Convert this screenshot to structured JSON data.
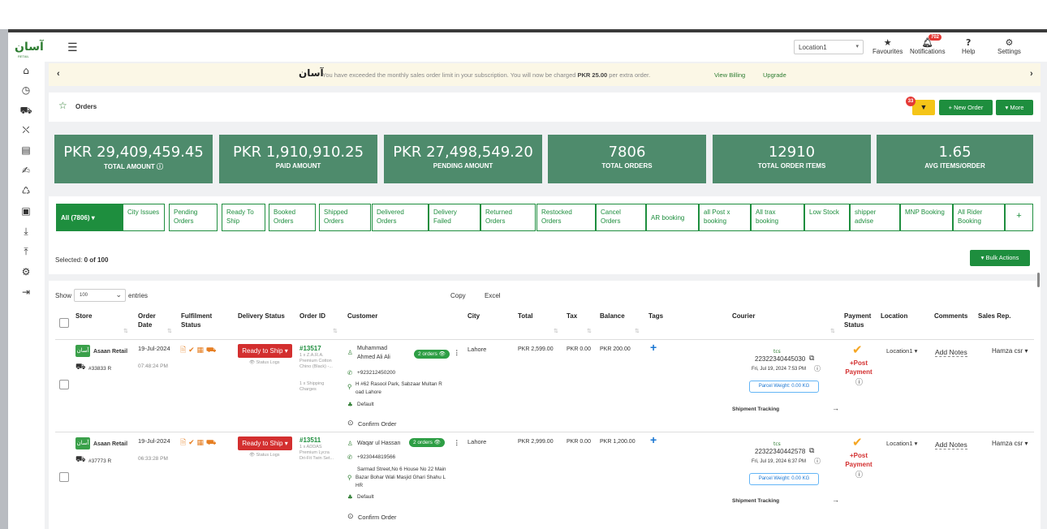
{
  "brand": {
    "logo": "آسان",
    "sub": "RETAIL"
  },
  "topbar": {
    "location": "Location1",
    "favourites": "Favourites",
    "notifications": "Notifications",
    "notif_count": "702",
    "help": "Help",
    "settings": "Settings"
  },
  "banner": {
    "message_pre": "You have exceeded the monthly sales order limit in your subscription. You will now be charged",
    "amount": "PKR 25.00",
    "message_post": "per extra order.",
    "view_billing": "View Billing",
    "upgrade": "Upgrade"
  },
  "header": {
    "title": "Orders",
    "filter_count": "33",
    "new_order": "+ New Order",
    "more": "▾ More"
  },
  "stats": [
    {
      "value": "PKR 29,409,459.45",
      "label": "TOTAL AMOUNT ⓘ"
    },
    {
      "value": "PKR 1,910,910.25",
      "label": "PAID AMOUNT"
    },
    {
      "value": "PKR 27,498,549.20",
      "label": "PENDING AMOUNT"
    },
    {
      "value": "7806",
      "label": "TOTAL ORDERS"
    },
    {
      "value": "12910",
      "label": "TOTAL ORDER ITEMS"
    },
    {
      "value": "1.65",
      "label": "AVG ITEMS/ORDER"
    }
  ],
  "tabs": {
    "all": "All   (7806)  ▾",
    "t1": "City Issues",
    "t2": "Pending Orders",
    "t3": "Ready To Ship",
    "t4": "Booked Orders",
    "t5": "Shipped Orders",
    "t6": "Delivered Orders",
    "t7": "Delivery Failed",
    "t8": "Returned Orders",
    "t9": "Restocked Orders",
    "t10": "Cancel Orders",
    "t11": "AR booking",
    "t12": "all Post x booking",
    "t13": "All trax booking",
    "t14": "Low Stock",
    "t15": "shipper advise",
    "t16": "MNP Booking",
    "t17": "All Rider Booking",
    "plus": "+"
  },
  "selection": {
    "label": "Selected:",
    "count": "0 of 100",
    "bulk": "▾  Bulk Actions"
  },
  "table": {
    "show": "Show",
    "page_size": "100",
    "entries": "entries",
    "copy": "Copy",
    "excel": "Excel",
    "headers": {
      "store": "Store",
      "order_date": "Order Date",
      "fulfilment": "Fulfilment Status",
      "delivery": "Delivery Status",
      "order_id": "Order ID",
      "customer": "Customer",
      "city": "City",
      "total": "Total",
      "tax": "Tax",
      "balance": "Balance",
      "tags": "Tags",
      "courier": "Courier",
      "payment": "Payment Status",
      "location": "Location",
      "comments": "Comments",
      "sales_rep": "Sales Rep."
    },
    "rows": [
      {
        "store": "Asaan Retail",
        "ref": "#33833 R",
        "date": "19-Jul-2024",
        "time": "07:48:24 PM",
        "status": "Ready to Ship ▾",
        "status_logs": "👁 Status Logs",
        "order_id": "#13517",
        "item1": "1 x Z.A.R.A.",
        "item2": "Premium Cotton",
        "item3": "Chino (Black) -...",
        "item4": "1 x Shipping",
        "item5": "Charges",
        "cust_name1": "Muhammad",
        "cust_name2": "Ahmed Ali Ali",
        "orders_pill": "2 orders 👁",
        "phone": "+923212450200",
        "addr1": "H #62 Rasool Park, Sabzaar Multan R",
        "addr2": "oad Lahore",
        "default": "Default",
        "confirm": "Confirm Order",
        "city": "Lahore",
        "total": "PKR 2,599.00",
        "tax": "PKR 0.00",
        "balance": "PKR 200.00",
        "tracking": "22322340445030",
        "track_date": "Fri, Jul 19, 2024 7:53 PM",
        "parcel": "Parcel Weight: 0.00 KG",
        "shipment": "Shipment Tracking",
        "post_payment": "+Post Payment",
        "location": "Location1 ▾",
        "add_notes": "Add Notes",
        "rep": "Hamza csr ▾"
      },
      {
        "store": "Asaan Retail",
        "ref": "#37773 R",
        "date": "19-Jul-2024",
        "time": "06:33:28 PM",
        "status": "Ready to Ship ▾",
        "status_logs": "👁 Status Logs",
        "order_id": "#13511",
        "item1": "1 x ADDAS",
        "item2": "Premium Lycra",
        "item3": "Dri-Fit Twin Set...",
        "cust_name1": "Waqar ul Hassan",
        "orders_pill": "2 orders 👁",
        "phone": "+923044819566",
        "addr1": "Sarmad Street,No 6 House No 22 Main",
        "addr2": "Bazar Bohar Wali Masjid Ghari Shahu L",
        "addr3": "HR",
        "default": "Default",
        "confirm": "Confirm Order",
        "city": "Lahore",
        "total": "PKR 2,999.00",
        "tax": "PKR 0.00",
        "balance": "PKR 1,200.00",
        "tracking": "22322340442578",
        "track_date": "Fri, Jul 19, 2024 6:37 PM",
        "parcel": "Parcel Weight: 0.00 KG",
        "shipment": "Shipment Tracking",
        "post_payment": "+Post Payment",
        "location": "Location1 ▾",
        "add_notes": "Add Notes",
        "rep": "Hamza csr ▾"
      }
    ]
  }
}
